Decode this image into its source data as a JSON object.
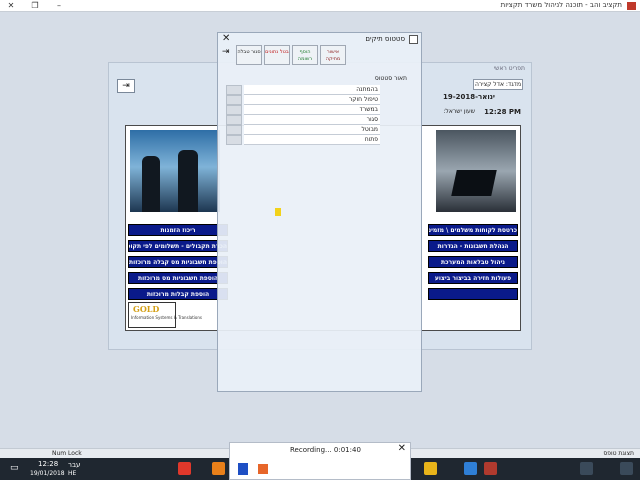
{
  "titlebar": {
    "app_title": "תקציב והב - תוכנה לניהול משרד תקציות"
  },
  "main_menu": {
    "title": "תפריט ראשי",
    "user": "מדגד: אדל קצירה",
    "date": "19-ינואר-2018",
    "time_label": "שעון ישראל:",
    "time": "12:28 PM",
    "right_buttons": [
      "כרטסת לקוחות משלמים \\ מזמינים",
      "הגהלת חשבונות - הגדרות",
      "ניהול טבלאות המערכת",
      "פעולות חזירה בביצור ביצוע"
    ],
    "left_buttons": [
      "ריכוז הזמנות",
      "הכרת תקבולים - תשלומים לפי תקופה",
      "הוספת חשבוניות מס קבלה מרוכזות",
      "הוספת חשבוניות מס מרוכזות",
      "הוספת קבלות מרוכזות"
    ],
    "logo": {
      "text": "GOLD",
      "sub": "Information Systems & Translations"
    }
  },
  "dialog": {
    "title": "סטטוס תיקים",
    "tabs": [
      {
        "label": "אישור מחיקה",
        "color": "#8b1a1a"
      },
      {
        "label": "הוסף רשומה",
        "color": "#1a7a2a"
      },
      {
        "label": "בטל נתונים",
        "color": "#c01a1a"
      },
      {
        "label": "סגור טבלה",
        "color": "#222222"
      }
    ],
    "list_header": "תאור סטטוס",
    "statuses": [
      "בהמתנה",
      "טיפול חוקר",
      "במשרד",
      "סגור",
      "מבוטל",
      "פתוח"
    ]
  },
  "recording": {
    "text": "Recording... 0:01:40"
  },
  "status_strip": {
    "left": "Num Lock",
    "right": "תצוגת טופס"
  },
  "taskbar": {
    "time": "12:28",
    "date": "19/01/2018",
    "lang": "עבר",
    "lang_code": "HE"
  }
}
